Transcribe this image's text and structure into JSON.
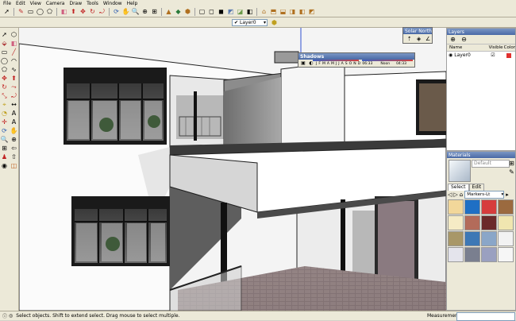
{
  "menu": [
    "File",
    "Edit",
    "View",
    "Camera",
    "Draw",
    "Tools",
    "Window",
    "Help"
  ],
  "layer_toolbar": {
    "current_layer": "Layer0"
  },
  "layers_panel": {
    "title": "Layers",
    "columns": {
      "name": "Name",
      "visible": "Visible",
      "color": "Color"
    },
    "rows": [
      {
        "name": "Layer0",
        "visible": true,
        "color": "#e0312f"
      }
    ]
  },
  "materials_panel": {
    "title": "Materials",
    "current_material": "Default",
    "tabs": [
      "Select",
      "Edit"
    ],
    "library": "Markers-Lt",
    "swatches": [
      "#f2d79a",
      "#1f6fc4",
      "#d63c3c",
      "#9b6a3f",
      "#f5ebc5",
      "#b36b5a",
      "#6b2a2a",
      "#f0e6b0",
      "#a89768",
      "#3d78b5",
      "#8aa6c8",
      "#f2f2f2",
      "#e4e4ec",
      "#7a7f8f",
      "#9aa0c0",
      "#f6f6f6"
    ]
  },
  "shadows_dialog": {
    "title": "Shadows",
    "months": "J F M A M J J A S O N D",
    "time_start": "06:33",
    "noon": "Noon",
    "time_end": "04:33"
  },
  "solar_dialog": {
    "title": "Solar North"
  },
  "statusbar": {
    "hint": "Select objects. Shift to extend select. Drag mouse to select multiple.",
    "measurements_label": "Measurements"
  },
  "colors": {
    "accent": "#4a6aa6",
    "toolbar_bg": "#ece9d8"
  }
}
